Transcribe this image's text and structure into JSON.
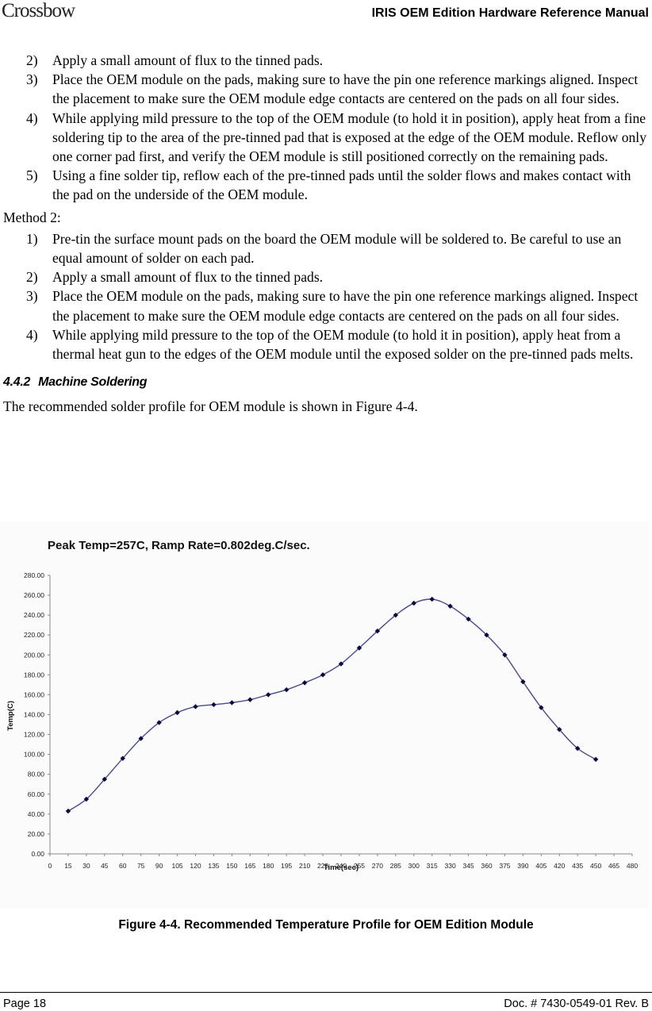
{
  "header": {
    "logo": "Crossbow",
    "title": "IRIS OEM Edition Hardware Reference Manual"
  },
  "method1_items": [
    {
      "num": "2)",
      "text": "Apply a small amount of flux to the tinned pads."
    },
    {
      "num": "3)",
      "text": "Place the OEM module on the pads, making sure to have the pin one reference markings aligned.  Inspect the placement to make sure the OEM module edge contacts are centered on the pads on all four sides."
    },
    {
      "num": "4)",
      "text": "While applying mild pressure to the top of the OEM module (to hold it in position), apply heat from a fine soldering tip to the area of the pre-tinned pad that is exposed at the edge of the OEM module.  Reflow only one corner pad first, and verify the OEM module is still positioned correctly on the remaining pads."
    },
    {
      "num": "5)",
      "text": "Using a fine solder tip, reflow each of the pre-tinned pads until the solder flows and makes contact with the pad on the underside of the OEM module."
    }
  ],
  "method2_label": "Method 2:",
  "method2_items": [
    {
      "num": "1)",
      "text": " Pre-tin the surface mount pads on the board the OEM module will be soldered to.  Be careful to use an equal amount of solder on each pad."
    },
    {
      "num": "2)",
      "text": "Apply a small amount of flux to the tinned pads."
    },
    {
      "num": "3)",
      "text": "Place the OEM module on the pads, making sure to have the pin one reference markings aligned.  Inspect the placement to make sure the OEM module edge contacts are centered on the pads on all four sides."
    },
    {
      "num": "4)",
      "text": "While applying mild pressure to the top of the OEM module (to hold it in position), apply heat from a thermal heat gun to the edges of the OEM module until the exposed solder on the pre-tinned pads melts."
    }
  ],
  "section": {
    "number": "4.4.2",
    "title": "Machine Soldering"
  },
  "intro": "The recommended solder profile for OEM module is shown in Figure 4-4.",
  "chart_data": {
    "type": "line",
    "title": "Peak Temp=257C, Ramp Rate=0.802deg.C/sec.",
    "xlabel": "Time(sec)",
    "ylabel": "Temp(C)",
    "xlim": [
      0,
      480
    ],
    "ylim": [
      0,
      280
    ],
    "x_ticks": [
      "0",
      "15",
      "30",
      "45",
      "60",
      "75",
      "90",
      "105",
      "120",
      "135",
      "150",
      "165",
      "180",
      "195",
      "210",
      "225",
      "240",
      "255",
      "270",
      "285",
      "300",
      "315",
      "330",
      "345",
      "360",
      "375",
      "390",
      "405",
      "420",
      "435",
      "450",
      "465",
      "480"
    ],
    "y_ticks": [
      "0.00",
      "20.00",
      "40.00",
      "60.00",
      "80.00",
      "100.00",
      "120.00",
      "140.00",
      "160.00",
      "180.00",
      "200.00",
      "220.00",
      "240.00",
      "260.00",
      "280.00"
    ],
    "grid": false,
    "line_color": "#4a4a8a",
    "marker_color": "#0a0a40",
    "x": [
      15,
      30,
      45,
      60,
      75,
      90,
      105,
      120,
      135,
      150,
      165,
      180,
      195,
      210,
      225,
      240,
      255,
      270,
      285,
      300,
      315,
      330,
      345,
      360,
      375,
      390,
      405,
      420,
      435,
      450
    ],
    "y": [
      43,
      55,
      75,
      96,
      116,
      132,
      142,
      148,
      150,
      152,
      155,
      160,
      165,
      172,
      180,
      191,
      207,
      224,
      240,
      252,
      256,
      249,
      236,
      220,
      200,
      173,
      147,
      125,
      106,
      95
    ]
  },
  "caption": "Figure 4-4. Recommended Temperature Profile for OEM Edition Module",
  "footer": {
    "page": "Page 18",
    "doc": "Doc. # 7430-0549-01 Rev. B"
  }
}
